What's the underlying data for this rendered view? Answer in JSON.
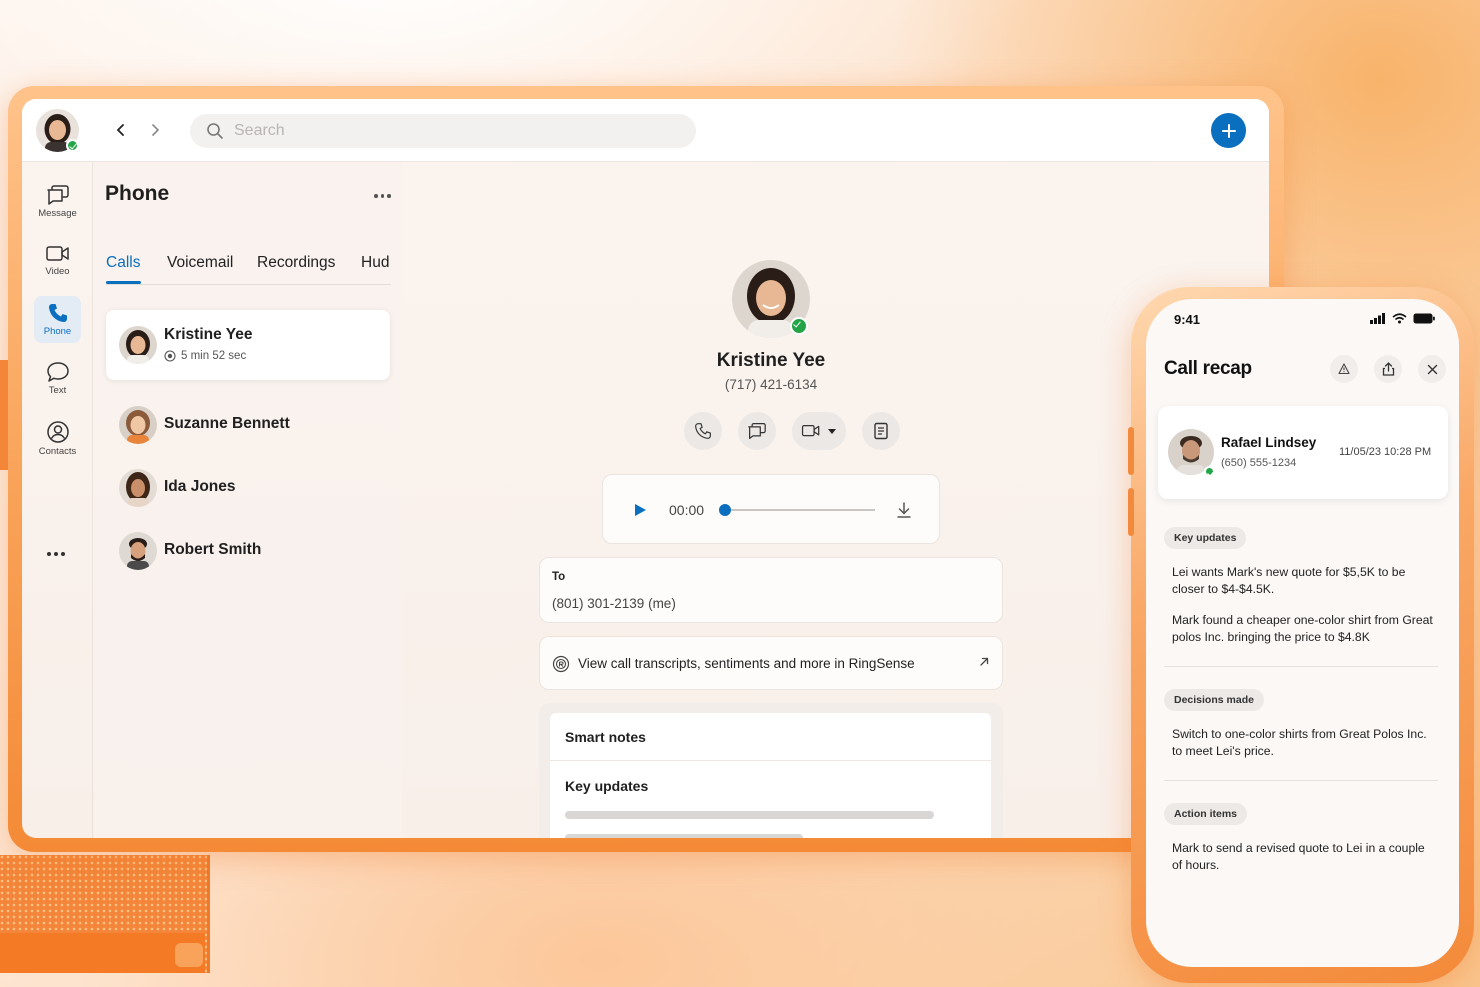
{
  "app": {
    "search": {
      "placeholder": "Search"
    },
    "rail": [
      {
        "key": "message",
        "label": "Message"
      },
      {
        "key": "video",
        "label": "Video"
      },
      {
        "key": "phone",
        "label": "Phone",
        "active": true
      },
      {
        "key": "text",
        "label": "Text"
      },
      {
        "key": "contacts",
        "label": "Contacts"
      }
    ],
    "colors": {
      "accent": "#0a6fbf",
      "presence": "#22a447",
      "brand_orange": "#f48a36"
    }
  },
  "phone_panel": {
    "title": "Phone",
    "tabs": [
      {
        "label": "Calls",
        "active": true
      },
      {
        "label": "Voicemail"
      },
      {
        "label": "Recordings"
      },
      {
        "label": "Hud"
      }
    ],
    "calls": [
      {
        "name": "Kristine Yee",
        "meta": "5 min 52 sec",
        "selected": true
      },
      {
        "name": "Suzanne Bennett"
      },
      {
        "name": "Ida Jones"
      },
      {
        "name": "Robert Smith"
      }
    ]
  },
  "detail": {
    "name": "Kristine Yee",
    "phone": "(717) 421-6134",
    "actions": [
      "phone-icon",
      "message-icon",
      "video-icon",
      "notes-icon"
    ],
    "player": {
      "time": "00:00",
      "progress": 0.0
    },
    "to": {
      "label": "To",
      "value": "(801) 301-2139 (me)"
    },
    "ringsense": {
      "text": "View call transcripts, sentiments and more in RingSense"
    },
    "smart_notes": {
      "title": "Smart notes",
      "section": "Key updates"
    }
  },
  "mobile": {
    "status_time": "9:41",
    "title": "Call recap",
    "contact": {
      "name": "Rafael Lindsey",
      "phone": "(650) 555-1234",
      "datetime": "11/05/23 10:28 PM"
    },
    "sections": [
      {
        "label": "Key updates",
        "items": [
          "Lei wants Mark's new quote for $5,5K to be closer to $4-$4.5K.",
          "Mark found a cheaper one-color shirt from Great polos Inc. bringing the price to $4.8K"
        ]
      },
      {
        "label": "Decisions made",
        "items": [
          "Switch to one-color shirts from Great Polos Inc. to meet Lei's price."
        ]
      },
      {
        "label": "Action items",
        "items": [
          "Mark to send a revised quote to Lei in a couple of hours."
        ]
      }
    ]
  }
}
